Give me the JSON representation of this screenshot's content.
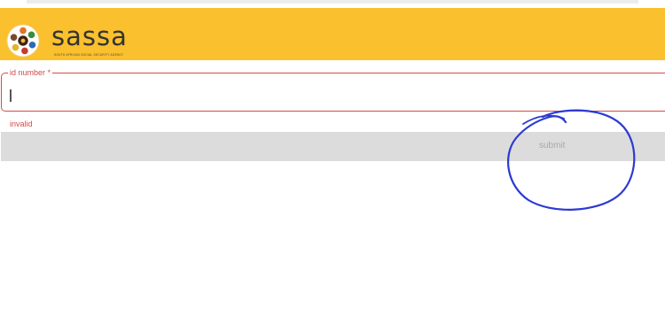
{
  "header": {
    "brand_name": "sassa",
    "brand_tagline": "SOUTH AFRICAN SOCIAL SECURITY AGENCY",
    "background_color": "#fbc02d",
    "logo_icon": "sassa-logo-icon"
  },
  "form": {
    "id_field": {
      "label": "id number *",
      "value": "",
      "border_color": "#d64a4a"
    },
    "error_message": "invalid",
    "submit_label": "submit"
  },
  "annotation": {
    "color": "#2b3ad3",
    "icon": "hand-drawn-circle-annotation"
  }
}
